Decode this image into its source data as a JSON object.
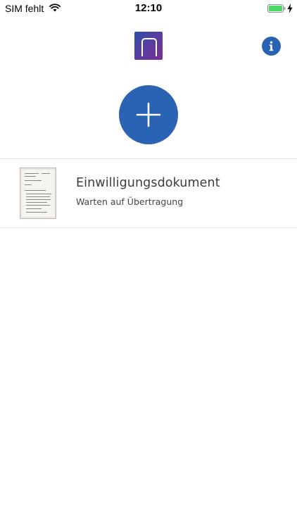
{
  "status_bar": {
    "carrier": "SIM fehlt",
    "time": "12:10",
    "battery_color": "#4cd964"
  },
  "header": {
    "logo_icon": "app-logo-icon",
    "info_icon": "info-icon",
    "accent_color": "#2a63b3"
  },
  "add_button": {
    "icon": "plus-icon"
  },
  "documents": [
    {
      "title": "Einwilligungsdokument",
      "status": "Warten auf Übertragung",
      "thumbnail_icon": "document-thumbnail"
    }
  ]
}
